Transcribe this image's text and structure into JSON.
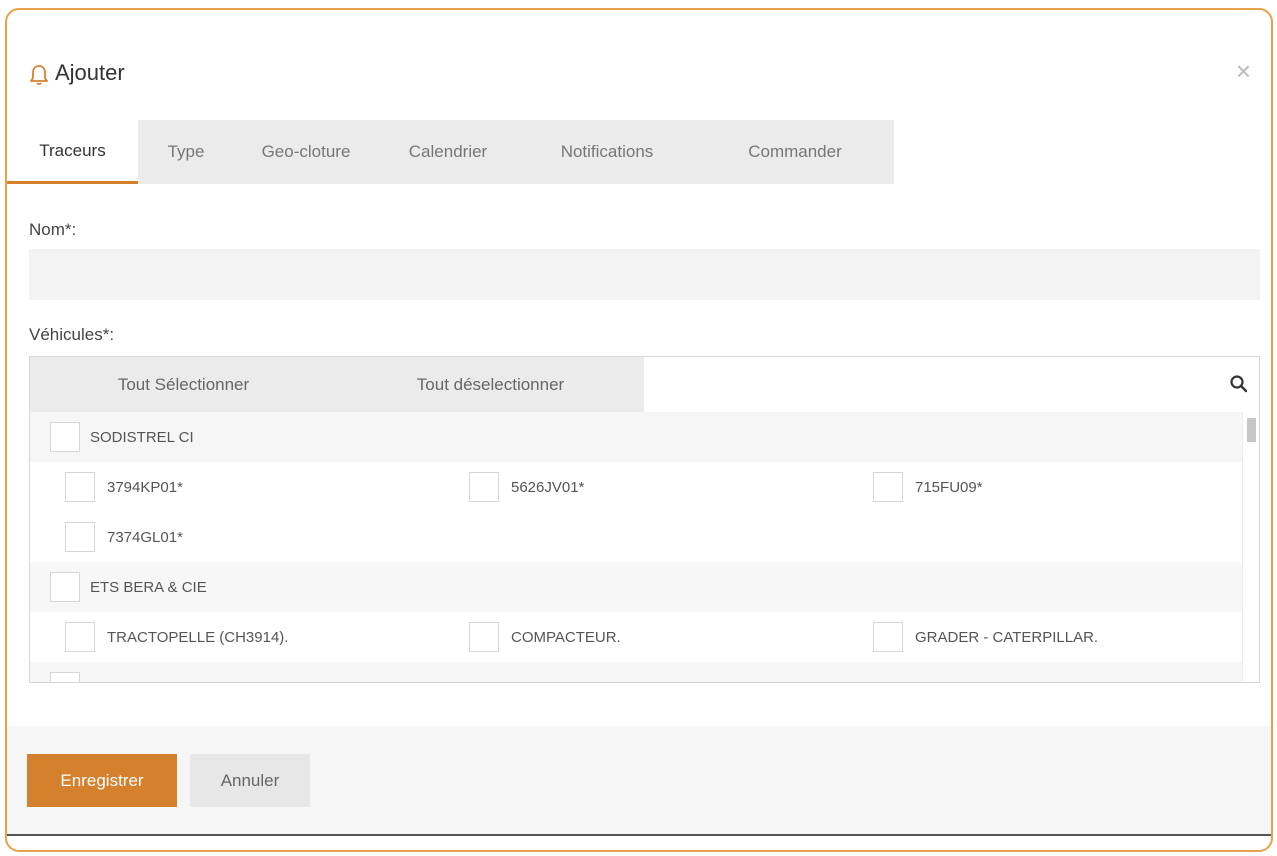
{
  "header": {
    "title": "Ajouter",
    "icon": "bell-icon",
    "close_symbol": "×"
  },
  "tabs": [
    {
      "label": "Traceurs",
      "active": true
    },
    {
      "label": "Type"
    },
    {
      "label": "Geo-cloture"
    },
    {
      "label": "Calendrier"
    },
    {
      "label": "Notifications"
    },
    {
      "label": "Commander"
    }
  ],
  "form": {
    "nom_label": "Nom*:",
    "nom_value": "",
    "vehicules_label": "Véhicules*:"
  },
  "vehicles": {
    "select_all": "Tout Sélectionner",
    "deselect_all": "Tout déselectionner",
    "groups": [
      {
        "name": "SODISTREL CI",
        "items": [
          "3794KP01*",
          "5626JV01*",
          "715FU09*",
          "7374GL01*"
        ]
      },
      {
        "name": "ETS BERA & CIE",
        "items": [
          "TRACTOPELLE (CH3914).",
          "COMPACTEUR.",
          "GRADER - CATERPILLAR."
        ]
      }
    ]
  },
  "footer": {
    "save_label": "Enregistrer",
    "cancel_label": "Annuler"
  },
  "colors": {
    "accent": "#d4802c",
    "frame_border": "#e8a24a",
    "tab_bar": "#ebebeb"
  }
}
